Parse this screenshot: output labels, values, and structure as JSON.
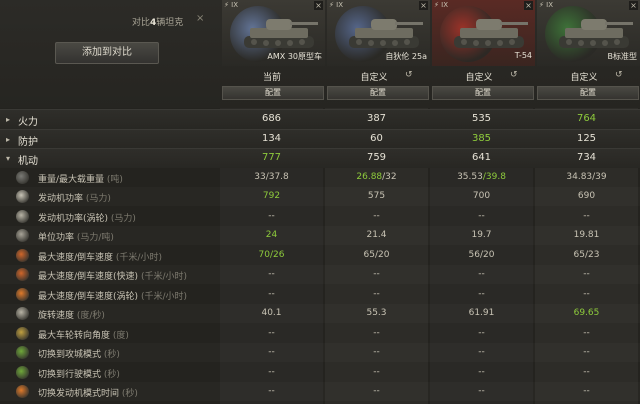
{
  "header": {
    "compare_prefix": "对比",
    "compare_count": "4",
    "compare_suffix": "辆坦克",
    "close": "×",
    "add_button": "添加到对比"
  },
  "tanks": [
    {
      "tier": "IX",
      "name": "AMX 30原型车",
      "label": "当前",
      "config": "配置",
      "reset": "",
      "flag_color": "#6a7fa8"
    },
    {
      "tier": "IX",
      "name": "自狄伦 25a",
      "label": "自定义",
      "config": "配置",
      "reset": "↺",
      "flag_color": "#5b6f9a"
    },
    {
      "tier": "IX",
      "name": "T-54",
      "label": "自定义",
      "config": "配置",
      "reset": "↺",
      "flag_color": "#a8342a"
    },
    {
      "tier": "IX",
      "name": "B标准型",
      "label": "自定义",
      "config": "配置",
      "reset": "↺",
      "flag_color": "#3f7d3a"
    }
  ],
  "sections": [
    {
      "key": "firepower",
      "label": "火力",
      "values": [
        "686",
        "387",
        "535",
        "764"
      ],
      "green": [
        false,
        false,
        false,
        true
      ]
    },
    {
      "key": "protection",
      "label": "防护",
      "values": [
        "134",
        "60",
        "385",
        "125"
      ],
      "green": [
        false,
        false,
        true,
        false
      ]
    },
    {
      "key": "mobility",
      "label": "机动",
      "values": [
        "777",
        "759",
        "641",
        "734"
      ],
      "green": [
        true,
        false,
        false,
        false
      ]
    }
  ],
  "rows": [
    {
      "icon": "weight-icon",
      "label": "重量/最大载重量",
      "unit": "(吨)",
      "values": [
        {
          "a": "33",
          "b": "/37.8",
          "ga": false,
          "gb": false
        },
        {
          "a": "26.88",
          "b": "/32",
          "ga": true,
          "gb": false
        },
        {
          "a": "35.53",
          "b": "/39.8",
          "ga": false,
          "gb": true
        },
        {
          "a": "34.83",
          "b": "/39",
          "ga": false,
          "gb": false
        }
      ]
    },
    {
      "icon": "engine-icon",
      "label": "发动机功率",
      "unit": "(马力)",
      "values": [
        {
          "a": "792",
          "b": "",
          "ga": true
        },
        {
          "a": "575",
          "b": ""
        },
        {
          "a": "700",
          "b": ""
        },
        {
          "a": "690",
          "b": ""
        }
      ]
    },
    {
      "icon": "turbo-icon",
      "label": "发动机功率(涡轮)",
      "unit": "(马力)",
      "values": [
        {
          "a": "--",
          "b": ""
        },
        {
          "a": "--",
          "b": ""
        },
        {
          "a": "--",
          "b": ""
        },
        {
          "a": "--",
          "b": ""
        }
      ]
    },
    {
      "icon": "power-ratio-icon",
      "label": "单位功率",
      "unit": "(马力/吨)",
      "values": [
        {
          "a": "24",
          "b": "",
          "ga": true
        },
        {
          "a": "21.4",
          "b": ""
        },
        {
          "a": "19.7",
          "b": ""
        },
        {
          "a": "19.81",
          "b": ""
        }
      ]
    },
    {
      "icon": "speed-icon",
      "label": "最大速度/倒车速度",
      "unit": "(千米/小时)",
      "values": [
        {
          "a": "70/26",
          "b": "",
          "ga": true
        },
        {
          "a": "65/20",
          "b": ""
        },
        {
          "a": "56/20",
          "b": ""
        },
        {
          "a": "65/23",
          "b": ""
        }
      ]
    },
    {
      "icon": "speed-fast-icon",
      "label": "最大速度/倒车速度(快速)",
      "unit": "(千米/小时)",
      "values": [
        {
          "a": "--",
          "b": ""
        },
        {
          "a": "--",
          "b": ""
        },
        {
          "a": "--",
          "b": ""
        },
        {
          "a": "--",
          "b": ""
        }
      ]
    },
    {
      "icon": "speed-turbo-icon",
      "label": "最大速度/倒车速度(涡轮)",
      "unit": "(千米/小时)",
      "values": [
        {
          "a": "--",
          "b": ""
        },
        {
          "a": "--",
          "b": ""
        },
        {
          "a": "--",
          "b": ""
        },
        {
          "a": "--",
          "b": ""
        }
      ]
    },
    {
      "icon": "traverse-icon",
      "label": "旋转速度",
      "unit": "(度/秒)",
      "values": [
        {
          "a": "40.1",
          "b": ""
        },
        {
          "a": "55.3",
          "b": ""
        },
        {
          "a": "61.91",
          "b": ""
        },
        {
          "a": "69.65",
          "b": "",
          "ga": true
        }
      ]
    },
    {
      "icon": "wheel-angle-icon",
      "label": "最大车轮转向角度",
      "unit": "(度)",
      "values": [
        {
          "a": "--",
          "b": ""
        },
        {
          "a": "--",
          "b": ""
        },
        {
          "a": "--",
          "b": ""
        },
        {
          "a": "--",
          "b": ""
        }
      ]
    },
    {
      "icon": "siege-mode-icon",
      "label": "切换到攻城模式",
      "unit": "(秒)",
      "values": [
        {
          "a": "--",
          "b": ""
        },
        {
          "a": "--",
          "b": ""
        },
        {
          "a": "--",
          "b": ""
        },
        {
          "a": "--",
          "b": ""
        }
      ]
    },
    {
      "icon": "travel-mode-icon",
      "label": "切换到行驶模式",
      "unit": "(秒)",
      "values": [
        {
          "a": "--",
          "b": ""
        },
        {
          "a": "--",
          "b": ""
        },
        {
          "a": "--",
          "b": ""
        },
        {
          "a": "--",
          "b": ""
        }
      ]
    },
    {
      "icon": "engine-mode-icon",
      "label": "切换发动机模式时间",
      "unit": "(秒)",
      "values": [
        {
          "a": "--",
          "b": ""
        },
        {
          "a": "--",
          "b": ""
        },
        {
          "a": "--",
          "b": ""
        },
        {
          "a": "--",
          "b": ""
        }
      ]
    }
  ]
}
